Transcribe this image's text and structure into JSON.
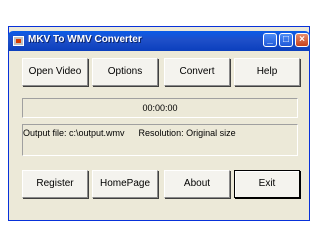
{
  "window": {
    "title": "MKV To WMV Converter",
    "controls": {
      "minimize": "_",
      "maximize": "□",
      "close": "×"
    }
  },
  "toolbar": {
    "buttons": [
      {
        "label": "Open Video"
      },
      {
        "label": "Options"
      },
      {
        "label": "Convert"
      },
      {
        "label": "Help"
      }
    ]
  },
  "status": {
    "time": "00:00:00",
    "output_file": "Output file: c:\\output.wmv",
    "resolution": "Resolution: Original size"
  },
  "footer": {
    "buttons": [
      {
        "label": "Register"
      },
      {
        "label": "HomePage"
      },
      {
        "label": "About"
      },
      {
        "label": "Exit"
      }
    ]
  }
}
